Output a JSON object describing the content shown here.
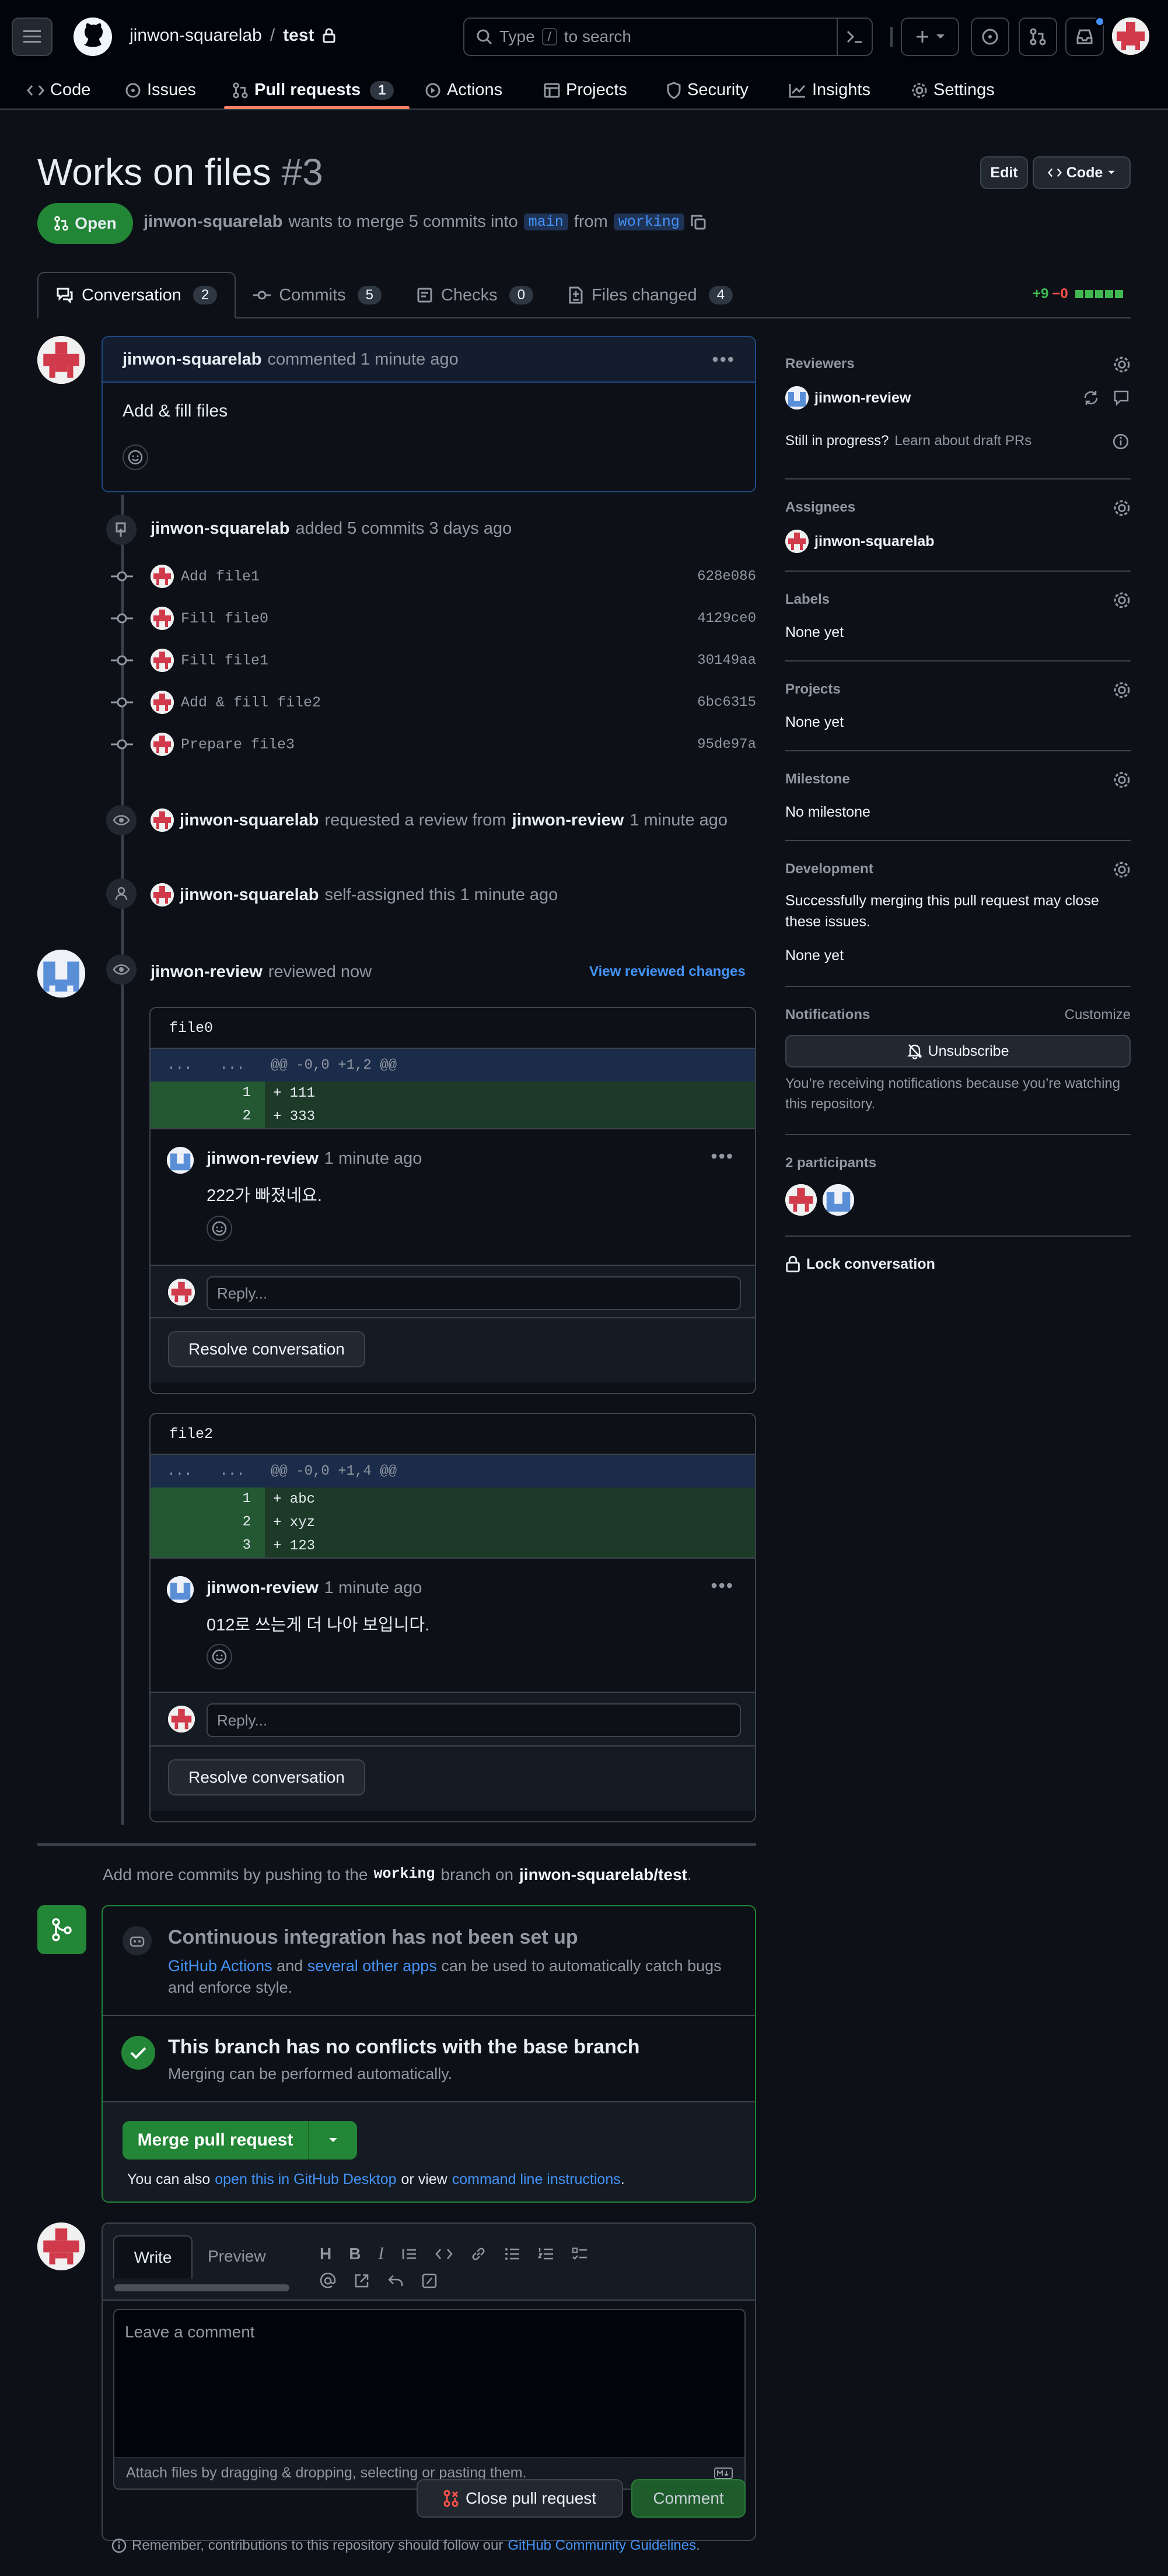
{
  "header": {
    "owner": "jinwon-squarelab",
    "separator": "/",
    "repo": "test",
    "search_placeholder": "Type / to search",
    "search_prefix": "Type",
    "search_key": "/",
    "search_suffix": "to search",
    "plus_label": "+"
  },
  "repo_nav": [
    {
      "label": "Code"
    },
    {
      "label": "Issues"
    },
    {
      "label": "Pull requests",
      "count": "1"
    },
    {
      "label": "Actions"
    },
    {
      "label": "Projects"
    },
    {
      "label": "Security"
    },
    {
      "label": "Insights"
    },
    {
      "label": "Settings"
    }
  ],
  "pr": {
    "title": "Works on files",
    "number": "#3",
    "edit_label": "Edit",
    "code_label": "Code",
    "state": "Open",
    "author": "jinwon-squarelab",
    "merge_text": "wants to merge 5 commits into",
    "base": "main",
    "from_text": "from",
    "head": "working"
  },
  "pr_tabs": [
    {
      "label": "Conversation",
      "count": "2"
    },
    {
      "label": "Commits",
      "count": "5"
    },
    {
      "label": "Checks",
      "count": "0"
    },
    {
      "label": "Files changed",
      "count": "4"
    }
  ],
  "diffstat": {
    "add": "+9",
    "del": "−0"
  },
  "first_comment": {
    "author": "jinwon-squarelab",
    "action": "commented 1 minute ago",
    "body": "Add & fill files"
  },
  "commits_event": {
    "author": "jinwon-squarelab",
    "text": "added 5 commits 3 days ago",
    "commits": [
      {
        "msg": "Add file1",
        "sha": "628e086"
      },
      {
        "msg": "Fill file0",
        "sha": "4129ce0"
      },
      {
        "msg": "Fill file1",
        "sha": "30149aa"
      },
      {
        "msg": "Add & fill file2",
        "sha": "6bc6315"
      },
      {
        "msg": "Prepare file3",
        "sha": "95de97a"
      }
    ]
  },
  "review_request": {
    "author": "jinwon-squarelab",
    "text": "requested a review from",
    "reviewer": "jinwon-review",
    "time": "1 minute ago"
  },
  "self_assign": {
    "author": "jinwon-squarelab",
    "text": "self-assigned this 1 minute ago"
  },
  "review": {
    "author": "jinwon-review",
    "text": "reviewed now",
    "view_changes": "View reviewed changes",
    "threads": [
      {
        "file": "file0",
        "hunk_dots": "...",
        "hunk_dots2": "...",
        "hunk": "@@ -0,0 +1,2 @@",
        "lines": [
          {
            "n": "1",
            "code": "+ 111"
          },
          {
            "n": "2",
            "code": "+ 333"
          }
        ],
        "comment_author": "jinwon-review",
        "comment_time": "1 minute ago",
        "comment_body": "222가 빠졌네요.",
        "reply_placeholder": "Reply...",
        "resolve_label": "Resolve conversation"
      },
      {
        "file": "file2",
        "hunk_dots": "...",
        "hunk_dots2": "...",
        "hunk": "@@ -0,0 +1,4 @@",
        "lines": [
          {
            "n": "1",
            "code": "+ abc"
          },
          {
            "n": "2",
            "code": "+ xyz"
          },
          {
            "n": "3",
            "code": "+ 123"
          }
        ],
        "comment_author": "jinwon-review",
        "comment_time": "1 minute ago",
        "comment_body": "012로 쓰는게 더 나아 보입니다.",
        "reply_placeholder": "Reply...",
        "resolve_label": "Resolve conversation"
      }
    ]
  },
  "push_hint": {
    "prefix": "Add more commits by pushing to the",
    "branch": "working",
    "middle": "branch on",
    "repo": "jinwon-squarelab/test",
    "end": "."
  },
  "merge_box": {
    "ci_title": "Continuous integration has not been set up",
    "ci_link1": "GitHub Actions",
    "ci_and": "and",
    "ci_link2": "several other apps",
    "ci_rest": "can be used to automatically catch bugs and enforce style.",
    "conflict_title": "This branch has no conflicts with the base branch",
    "conflict_sub": "Merging can be performed automatically.",
    "merge_label": "Merge pull request",
    "also_prefix": "You can also",
    "also_link1": "open this in GitHub Desktop",
    "also_mid": "or view",
    "also_link2": "command line instructions",
    "also_end": "."
  },
  "composer": {
    "write_tab": "Write",
    "preview_tab": "Preview",
    "placeholder": "Leave a comment",
    "attach": "Attach files by dragging & dropping, selecting or pasting them.",
    "close_label": "Close pull request",
    "comment_label": "Comment",
    "footer_prefix": "Remember, contributions to this repository should follow our",
    "footer_link": "GitHub Community Guidelines",
    "footer_end": "."
  },
  "sidebar": {
    "reviewers_head": "Reviewers",
    "reviewer": "jinwon-review",
    "draft_q": "Still in progress?",
    "draft_link": "Learn about draft PRs",
    "assignees_head": "Assignees",
    "assignee": "jinwon-squarelab",
    "labels_head": "Labels",
    "labels_val": "None yet",
    "projects_head": "Projects",
    "projects_val": "None yet",
    "milestone_head": "Milestone",
    "milestone_val": "No milestone",
    "dev_head": "Development",
    "dev_text": "Successfully merging this pull request may close these issues.",
    "dev_val": "None yet",
    "notif_head": "Notifications",
    "customize": "Customize",
    "unsubscribe": "Unsubscribe",
    "notif_text": "You’re receiving notifications because you’re watching this repository.",
    "participants": "2 participants",
    "lock": "Lock conversation"
  },
  "colors": {
    "green": "#238636",
    "accent": "#4493f8",
    "red": "#f85149"
  }
}
